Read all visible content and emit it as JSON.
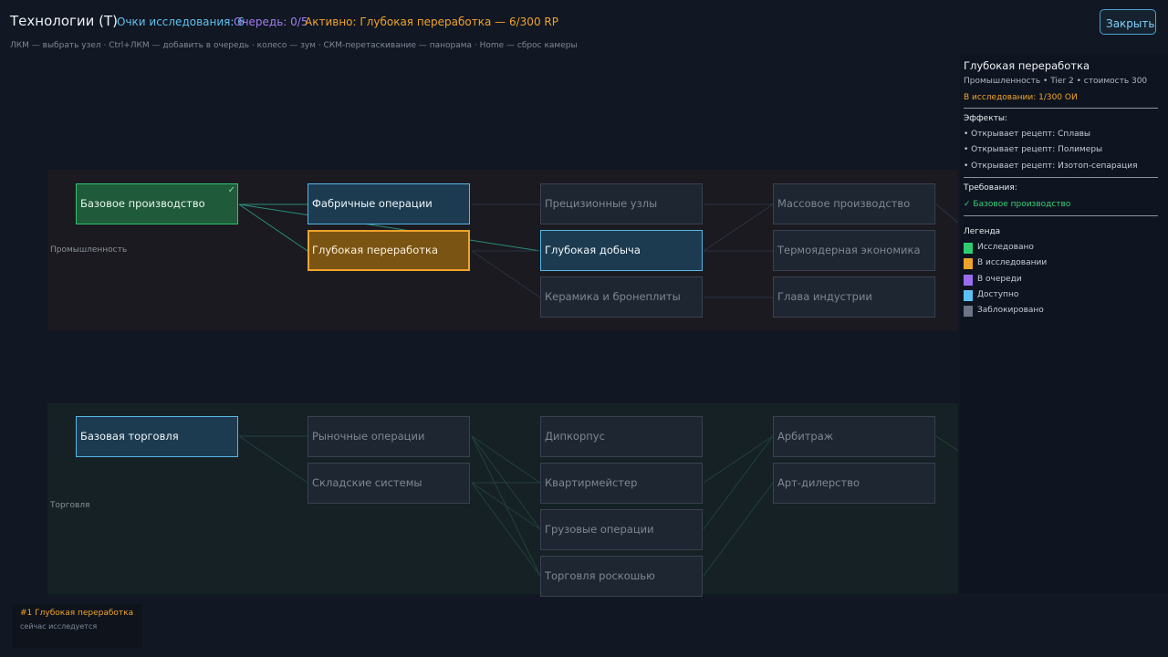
{
  "header": {
    "title": "Технологии (T)",
    "points_label": "Очки исследования: 6",
    "queue_label": "Очередь: 0/5",
    "active_label": "Активно: Глубокая переработка — 6/300 RP",
    "hint": "ЛКМ — выбрать узел · Ctrl+ЛКМ — добавить в очередь · колесо — зум · СКМ-перетаскивание — панорама · Home — сброс камеры",
    "close_label": "Закрыть"
  },
  "lanes": {
    "industry": {
      "label": "Промышленность"
    },
    "trade": {
      "label": "Торговля"
    }
  },
  "nodes": {
    "basic_production": {
      "label": "Базовое производство",
      "state": "researched",
      "check": "✓"
    },
    "factory_ops": {
      "label": "Фабричные операции",
      "state": "available"
    },
    "deep_processing": {
      "label": "Глубокая переработка",
      "state": "researching"
    },
    "precision_units": {
      "label": "Прецизионные узлы",
      "state": "locked"
    },
    "deep_mining": {
      "label": "Глубокая добыча",
      "state": "available"
    },
    "ceramics": {
      "label": "Керамика и бронеплиты",
      "state": "locked"
    },
    "mass_production": {
      "label": "Массовое производство",
      "state": "locked"
    },
    "fusion_economy": {
      "label": "Термоядерная экономика",
      "state": "locked"
    },
    "industry_chief": {
      "label": "Глава индустрии",
      "state": "locked"
    },
    "basic_trade": {
      "label": "Базовая торговля",
      "state": "available"
    },
    "market_ops": {
      "label": "Рыночные операции",
      "state": "locked"
    },
    "warehouse": {
      "label": "Складские системы",
      "state": "locked"
    },
    "diplomatic": {
      "label": "Дипкорпус",
      "state": "locked"
    },
    "quartermaster": {
      "label": "Квартирмейстер",
      "state": "locked"
    },
    "cargo_ops": {
      "label": "Грузовые операции",
      "state": "locked"
    },
    "luxury_trade": {
      "label": "Торговля роскошью",
      "state": "locked"
    },
    "arbitrage": {
      "label": "Арбитраж",
      "state": "locked"
    },
    "art_dealing": {
      "label": "Арт-дилерство",
      "state": "locked"
    }
  },
  "side": {
    "title": "Глубокая переработка",
    "subtitle": "Промышленность • Tier 2 • стоимость 300",
    "status": "В исследовании: 1/300 ОИ",
    "effects_title": "Эффекты:",
    "effects": [
      "• Открывает рецепт: Сплавы",
      "• Открывает рецепт: Полимеры",
      "• Открывает рецепт: Изотоп-сепарация"
    ],
    "requirements_title": "Требования:",
    "requirements": [
      "✓ Базовое производство"
    ],
    "legend_title": "Легенда",
    "legend": [
      {
        "label": "Исследовано",
        "color": "#2ecc71"
      },
      {
        "label": "В исследовании",
        "color": "#f0a32a"
      },
      {
        "label": "В очереди",
        "color": "#9b6cf0"
      },
      {
        "label": "Доступно",
        "color": "#5bc0f5"
      },
      {
        "label": "Заблокировано",
        "color": "#6c7585"
      }
    ]
  },
  "queue": {
    "title": "#1 Глубокая переработка",
    "note": "сейчас исследуется"
  },
  "colors": {
    "researched": "#2ecc71",
    "researching": "#f0a32a",
    "queued": "#9b6cf0",
    "available": "#5bc0f5",
    "locked": "#6c7585"
  }
}
